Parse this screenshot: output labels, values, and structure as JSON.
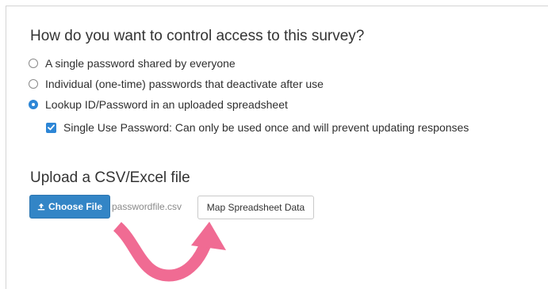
{
  "access": {
    "question": "How do you want to control access to this survey?",
    "options": [
      {
        "label": "A single password shared by everyone",
        "selected": false
      },
      {
        "label": "Individual (one-time) passwords that deactivate after use",
        "selected": false
      },
      {
        "label": "Lookup ID/Password in an uploaded spreadsheet",
        "selected": true
      }
    ],
    "single_use": {
      "label": "Single Use Password: Can only be used once and will prevent updating responses",
      "checked": true
    }
  },
  "upload": {
    "heading": "Upload a CSV/Excel file",
    "choose_file_label": "Choose File",
    "file_name": "passwordfile.csv",
    "map_button_label": "Map Spreadsheet Data"
  },
  "colors": {
    "accent": "#2d86d6",
    "choose_button": "#3385c6",
    "arrow": "#f06b93"
  },
  "icons": {
    "choose_file": "upload-icon",
    "pointer": "curved-arrow-icon"
  }
}
